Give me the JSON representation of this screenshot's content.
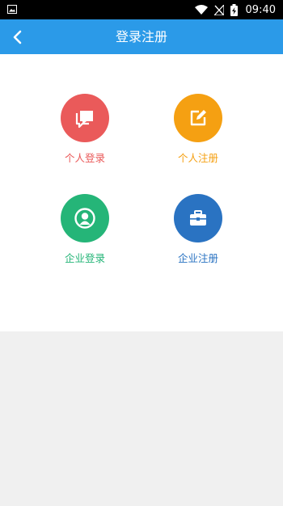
{
  "status_bar": {
    "time": "09:40",
    "icons": [
      "image-icon",
      "wifi-icon",
      "no-signal-icon",
      "battery-charging-icon"
    ]
  },
  "app_bar": {
    "title": "登录注册",
    "back_icon": "chevron-left-icon"
  },
  "tiles": [
    {
      "label": "个人登录",
      "icon": "chat-bubbles-icon",
      "color": "#ea5a5a"
    },
    {
      "label": "个人注册",
      "icon": "edit-icon",
      "color": "#f5a012"
    },
    {
      "label": "企业登录",
      "icon": "user-circle-icon",
      "color": "#25b578"
    },
    {
      "label": "企业注册",
      "icon": "briefcase-icon",
      "color": "#2a73c2"
    }
  ],
  "colors": {
    "app_bar": "#2b9ae8",
    "status_bar": "#000000",
    "page_background": "#f0f0f0"
  }
}
